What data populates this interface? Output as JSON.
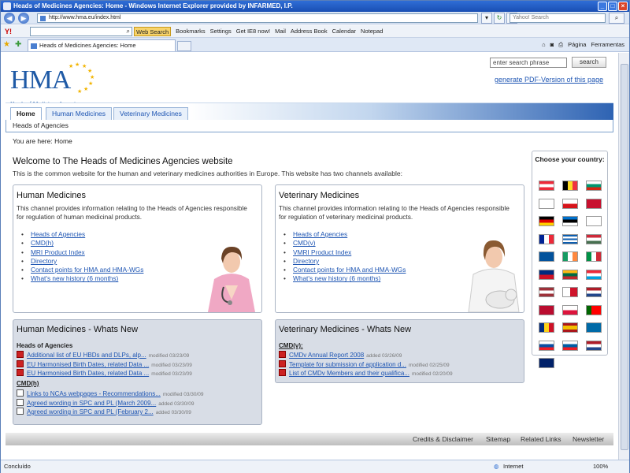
{
  "browser": {
    "window_title": "Heads of Medicines Agencies: Home - Windows Internet Explorer provided by INFARMED, I.P.",
    "address": "http://www.hma.eu/index.html",
    "search_placeholder": "Yahoo! Search",
    "tab_title": "Heads of Medicines Agencies: Home",
    "page_menu": "Página",
    "tools_menu": "Ferramentas",
    "status_text": "Concluído",
    "zone": "Internet",
    "zoom": "100%"
  },
  "yahoo_toolbar": {
    "logo": "Y!",
    "web_search": "Web Search",
    "items": [
      "Bookmarks",
      "Settings",
      "Get IE8 now!",
      "Mail",
      "Address Book",
      "Calendar",
      "Notepad"
    ]
  },
  "site": {
    "logo_text": "HMA",
    "logo_sub": "Heads of Medicines Agencies",
    "search_placeholder": "enter search phrase",
    "search_button": "search",
    "pdf_link": "generate PDF-Version of this page",
    "nav_tabs": [
      "Home",
      "Human Medicines",
      "Veterinary Medicines"
    ],
    "subnav": "Heads of Agencies",
    "breadcrumb": "You are here: Home",
    "welcome_title": "Welcome to The Heads of Medicines Agencies website",
    "welcome_text": "This is the common website for the human and veterinary medicines authorities in Europe. This website has two channels available:"
  },
  "human": {
    "title": "Human Medicines",
    "text": "This channel provides information relating to the Heads of Agencies responsible for regulation of human medicinal products.",
    "links": [
      "Heads of Agencies",
      "CMD(h)",
      "MRI Product Index",
      "Directory",
      "Contact points for HMA and HMA-WGs",
      "What's new history (6 months)"
    ]
  },
  "veterinary": {
    "title": "Veterinary Medicines",
    "text": "This channel provides information relating to the Heads of Agencies responsible for regulation of veterinary medicinal products.",
    "links": [
      "Heads of Agencies",
      "CMD(v)",
      "VMRI Product Index",
      "Directory",
      "Contact points for HMA and HMA-WGs",
      "What's new history (6 months)"
    ]
  },
  "human_news": {
    "title": "Human Medicines - Whats New",
    "sections": [
      {
        "name": "Heads of Agencies",
        "items": [
          {
            "title": "Additional list of EU HBDs and DLPs, alp...",
            "date": "modified 03/23/09",
            "icon": "pdf"
          },
          {
            "title": "EU Harmonised Birth Dates, related Data ...",
            "date": "modified 03/23/09",
            "icon": "pdf"
          },
          {
            "title": "EU Harmonised Birth Dates, related Data ...",
            "date": "modified 03/23/09",
            "icon": "pdf"
          }
        ]
      },
      {
        "name": "CMD(h)",
        "items": [
          {
            "title": "Links to NCAs webpages - Recommendations...",
            "date": "modified 03/30/09",
            "icon": "doc"
          },
          {
            "title": "Agreed wording in SPC and PL (March 2009...",
            "date": "added 03/30/09",
            "icon": "doc"
          },
          {
            "title": "Agreed wording in SPC and PL (February 2...",
            "date": "added 03/30/09",
            "icon": "doc"
          }
        ]
      }
    ]
  },
  "vet_news": {
    "title": "Veterinary Medicines - Whats New",
    "sections": [
      {
        "name": "CMD(v):",
        "items": [
          {
            "title": "CMDv Annual Report 2008",
            "date": "added 03/26/09",
            "icon": "pdf"
          },
          {
            "title": "Template for submission of application d...",
            "date": "modified 02/25/09",
            "icon": "pdf"
          },
          {
            "title": "List of CMDv Members and their qualifica...",
            "date": "modified 02/20/09",
            "icon": "pdf"
          }
        ]
      }
    ]
  },
  "countries": {
    "title": "Choose your country:",
    "flags": [
      {
        "name": "austria-flag",
        "stripes": [
          "#ed2939",
          "#ffffff",
          "#ed2939"
        ],
        "dir": "h"
      },
      {
        "name": "belgium-flag",
        "stripes": [
          "#000000",
          "#fdda24",
          "#ef3340"
        ],
        "dir": "v"
      },
      {
        "name": "bulgaria-flag",
        "stripes": [
          "#ffffff",
          "#00966e",
          "#d62612"
        ],
        "dir": "h"
      },
      {
        "name": "cyprus-flag",
        "stripes": [
          "#ffffff"
        ],
        "dir": "h"
      },
      {
        "name": "czech-flag",
        "stripes": [
          "#ffffff",
          "#d7141a"
        ],
        "dir": "h"
      },
      {
        "name": "denmark-flag",
        "stripes": [
          "#c8102e"
        ],
        "dir": "h"
      },
      {
        "name": "germany-flag",
        "stripes": [
          "#000000",
          "#dd0000",
          "#ffce00"
        ],
        "dir": "h"
      },
      {
        "name": "estonia-flag",
        "stripes": [
          "#0072ce",
          "#000000",
          "#ffffff"
        ],
        "dir": "h"
      },
      {
        "name": "finland-flag",
        "stripes": [
          "#ffffff"
        ],
        "dir": "h"
      },
      {
        "name": "france-flag",
        "stripes": [
          "#002395",
          "#ffffff",
          "#ed2939"
        ],
        "dir": "v"
      },
      {
        "name": "greece-flag",
        "stripes": [
          "#0d5eaf",
          "#ffffff",
          "#0d5eaf",
          "#ffffff",
          "#0d5eaf"
        ],
        "dir": "h"
      },
      {
        "name": "hungary-flag",
        "stripes": [
          "#ce2939",
          "#ffffff",
          "#477050"
        ],
        "dir": "h"
      },
      {
        "name": "iceland-flag",
        "stripes": [
          "#02529c"
        ],
        "dir": "h"
      },
      {
        "name": "ireland-flag",
        "stripes": [
          "#169b62",
          "#ffffff",
          "#ff883e"
        ],
        "dir": "v"
      },
      {
        "name": "italy-flag",
        "stripes": [
          "#009246",
          "#ffffff",
          "#ce2b37"
        ],
        "dir": "v"
      },
      {
        "name": "liechtenstein-flag",
        "stripes": [
          "#002b7f",
          "#ce1126"
        ],
        "dir": "h"
      },
      {
        "name": "lithuania-flag",
        "stripes": [
          "#fdb913",
          "#006a44",
          "#c1272d"
        ],
        "dir": "h"
      },
      {
        "name": "luxembourg-flag",
        "stripes": [
          "#ed2939",
          "#ffffff",
          "#00a1de"
        ],
        "dir": "h"
      },
      {
        "name": "latvia-flag",
        "stripes": [
          "#9e3039",
          "#ffffff",
          "#9e3039"
        ],
        "dir": "h"
      },
      {
        "name": "malta-flag",
        "stripes": [
          "#ffffff",
          "#cf142b"
        ],
        "dir": "v"
      },
      {
        "name": "netherlands-flag",
        "stripes": [
          "#ae1c28",
          "#ffffff",
          "#21468b"
        ],
        "dir": "h"
      },
      {
        "name": "norway-flag",
        "stripes": [
          "#ba0c2f"
        ],
        "dir": "h"
      },
      {
        "name": "poland-flag",
        "stripes": [
          "#ffffff",
          "#dc143c"
        ],
        "dir": "h"
      },
      {
        "name": "portugal-flag",
        "stripes": [
          "#006600",
          "#ff0000",
          "#ff0000"
        ],
        "dir": "v"
      },
      {
        "name": "romania-flag",
        "stripes": [
          "#002b7f",
          "#fcd116",
          "#ce1126"
        ],
        "dir": "v"
      },
      {
        "name": "spain-flag",
        "stripes": [
          "#aa151b",
          "#f1bf00",
          "#f1bf00",
          "#aa151b"
        ],
        "dir": "h"
      },
      {
        "name": "sweden-flag",
        "stripes": [
          "#006aa7"
        ],
        "dir": "h"
      },
      {
        "name": "slovakia-flag",
        "stripes": [
          "#ffffff",
          "#0b4ea2",
          "#ee1c25"
        ],
        "dir": "h"
      },
      {
        "name": "slovenia-flag",
        "stripes": [
          "#ffffff",
          "#005da4",
          "#ed1c24"
        ],
        "dir": "h"
      },
      {
        "name": "netherlands-flag-2",
        "stripes": [
          "#ae1c28",
          "#ffffff",
          "#21468b"
        ],
        "dir": "h"
      },
      {
        "name": "uk-flag",
        "stripes": [
          "#012169"
        ],
        "dir": "h"
      }
    ]
  },
  "footer": {
    "links": [
      "Credits & Disclaimer",
      "Sitemap",
      "Related Links",
      "Newsletter"
    ]
  }
}
